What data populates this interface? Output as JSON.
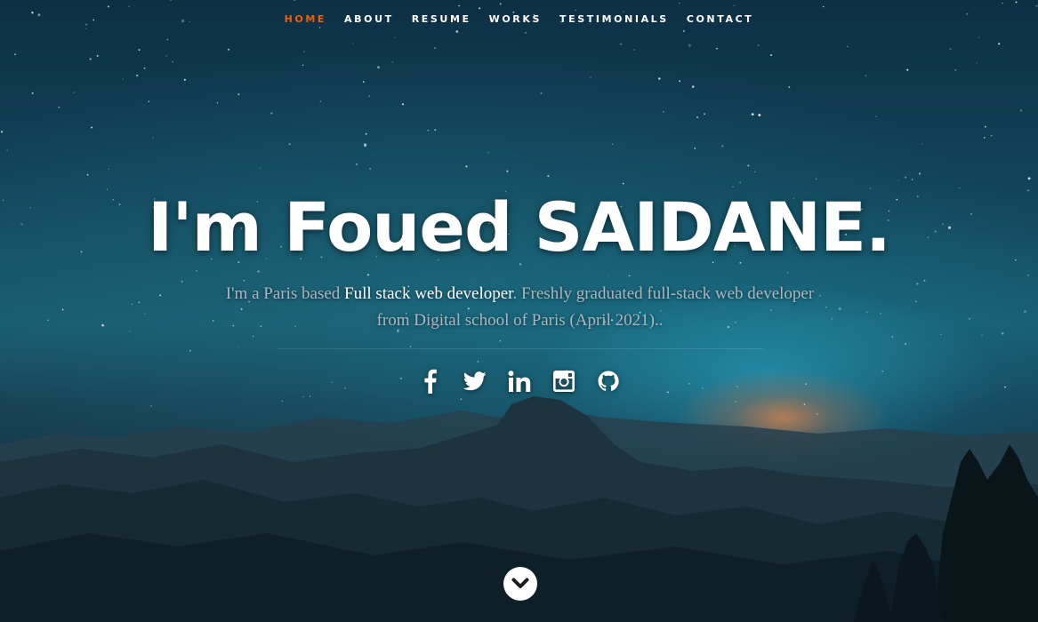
{
  "nav": {
    "items": [
      {
        "label": "HOME",
        "active": true
      },
      {
        "label": "ABOUT",
        "active": false
      },
      {
        "label": "RESUME",
        "active": false
      },
      {
        "label": "WORKS",
        "active": false
      },
      {
        "label": "TESTIMONIALS",
        "active": false
      },
      {
        "label": "CONTACT",
        "active": false
      }
    ],
    "active_color": "#f06000"
  },
  "hero": {
    "headline": "I'm Foued SAIDANE.",
    "intro_before": "I'm a Paris based ",
    "intro_highlight": "Full stack web developer",
    "intro_after": ". Freshly graduated full-stack web developer from Digital school of Paris (April 2021).."
  },
  "social": [
    {
      "icon": "facebook-icon"
    },
    {
      "icon": "twitter-icon"
    },
    {
      "icon": "linkedin-icon"
    },
    {
      "icon": "instagram-icon"
    },
    {
      "icon": "github-icon"
    }
  ],
  "scroll": {
    "icon": "chevron-down-icon"
  }
}
